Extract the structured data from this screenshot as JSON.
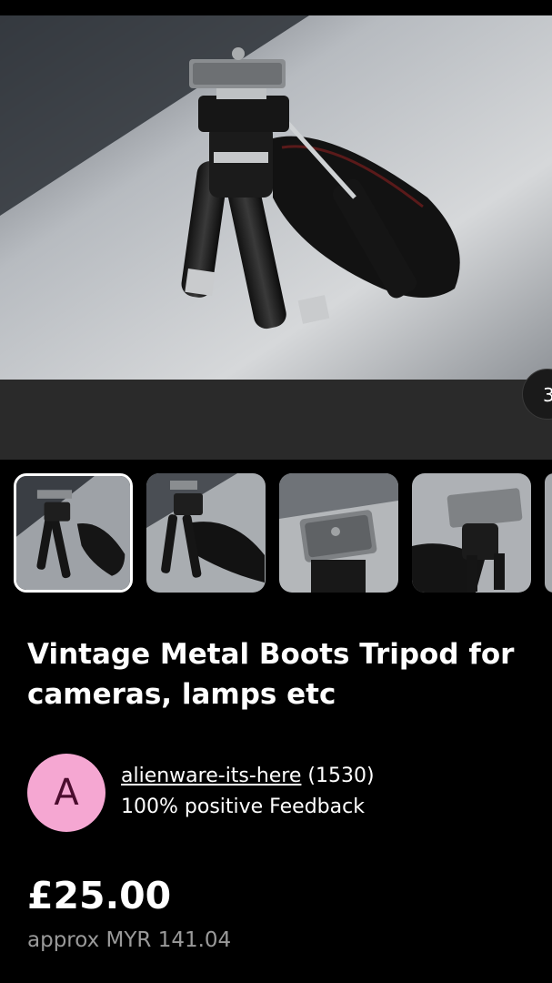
{
  "gallery": {
    "counter": "3",
    "thumbnails": [
      {
        "alt": "tripod-thumb-1",
        "active": true
      },
      {
        "alt": "tripod-thumb-2",
        "active": false
      },
      {
        "alt": "tripod-thumb-3",
        "active": false
      },
      {
        "alt": "tripod-thumb-4",
        "active": false
      }
    ]
  },
  "listing": {
    "title": "Vintage Metal Boots Tripod for cameras, lamps etc"
  },
  "seller": {
    "avatar_letter": "A",
    "name": "alienware-its-here",
    "count": "(1530)",
    "feedback": "100% positive Feedback"
  },
  "price": {
    "amount": "£25.00",
    "approx": "approx MYR 141.04"
  },
  "colors": {
    "background": "#000000",
    "avatar_bg": "#f5a7d2",
    "avatar_text": "#4b0c2e",
    "muted_text": "#9a9a9a"
  }
}
